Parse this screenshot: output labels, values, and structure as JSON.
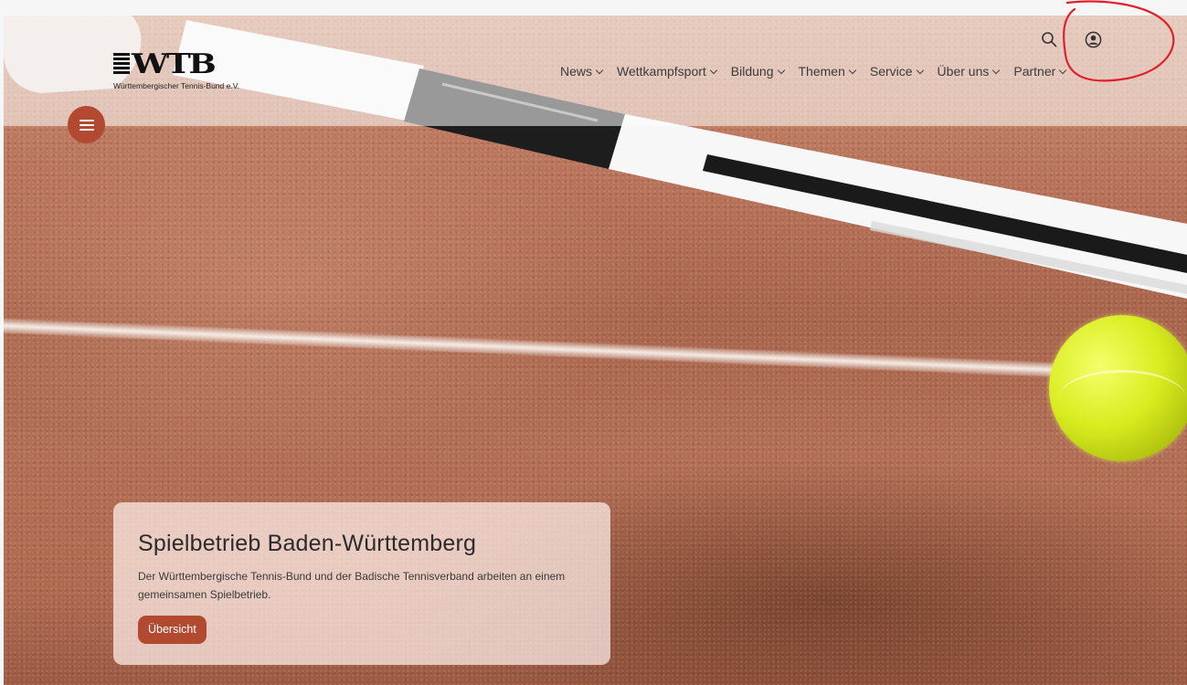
{
  "logo": {
    "mark": "WTB",
    "subtitle": "Württembergischer Tennis-Bund e.V."
  },
  "nav": {
    "items": [
      {
        "label": "News"
      },
      {
        "label": "Wettkampfsport"
      },
      {
        "label": "Bildung"
      },
      {
        "label": "Themen"
      },
      {
        "label": "Service"
      },
      {
        "label": "Über uns"
      },
      {
        "label": "Partner"
      }
    ]
  },
  "icons": {
    "search": "search-icon",
    "account": "user-icon",
    "menu": "hamburger-menu-icon"
  },
  "teaser": {
    "title": "Spielbetrieb Baden-Württemberg",
    "text": "Der Württembergische Tennis-Bund und der Badische Tennisverband arbeiten an einem gemeinsamen Spielbetrieb.",
    "button_label": "Übersicht"
  },
  "colors": {
    "accent": "#b24a32",
    "annotation": "#e0202a"
  }
}
